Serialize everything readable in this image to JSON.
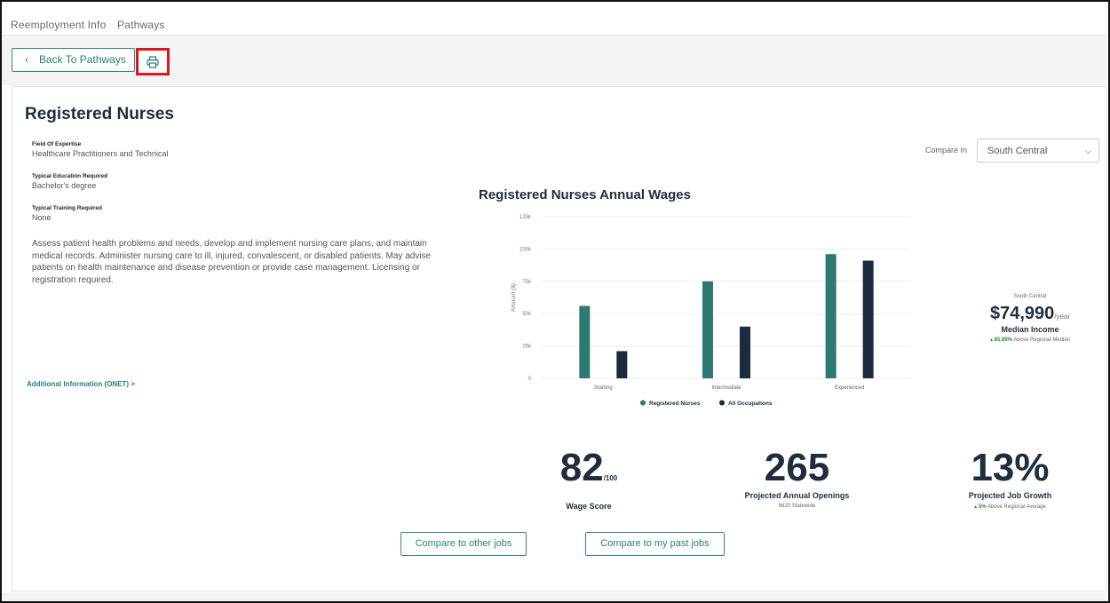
{
  "nav": {
    "reemployment_info": "Reemployment Info",
    "pathways": "Pathways",
    "back_button": "Back To Pathways",
    "print_icon": "printer-icon"
  },
  "occupation": {
    "title": "Registered Nurses",
    "field_of_expertise_label": "Field Of Expertise",
    "field_of_expertise": "Healthcare Practitioners and Technical",
    "education_label": "Typical Education Required",
    "education": "Bachelor's degree",
    "training_label": "Typical Training Required",
    "training": "None",
    "description": "Assess patient health problems and needs, develop and implement nursing care plans, and maintain medical records. Administer nursing care to ill, injured, convalescent, or disabled patients. May advise patients on health maintenance and disease prevention or provide case management. Licensing or registration required.",
    "additional_info": "Additional Information (ONET) >"
  },
  "compare": {
    "label": "Compare In",
    "selected_region": "South Central"
  },
  "median_income": {
    "region": "South Central",
    "value": "$74,990",
    "per": "/year",
    "label": "Median Income",
    "delta": "85.89%",
    "delta_text": "Above Regional Median"
  },
  "stats": {
    "wage_score": "82",
    "wage_score_suffix": "/100",
    "wage_score_label": "Wage Score",
    "openings": "265",
    "openings_label": "Projected Annual Openings",
    "openings_note": "6620 Statewide",
    "growth": "13%",
    "growth_label": "Projected Job Growth",
    "growth_delta": "5%",
    "growth_delta_text": "Above Regional Average"
  },
  "buttons": {
    "compare_other": "Compare to other jobs",
    "compare_past": "Compare to my past jobs"
  },
  "colors": {
    "accent": "#2a7d78",
    "registered_nurses": "#2a7a72",
    "all_occupations": "#1b2a3f",
    "print_highlight": "#e2141c"
  },
  "chart_data": {
    "type": "bar",
    "title": "Registered Nurses Annual Wages",
    "ylabel": "Amount ($)",
    "xlabel": "",
    "ylim": [
      0,
      125000
    ],
    "ytick_values": [
      0,
      25000,
      50000,
      75000,
      100000,
      125000
    ],
    "ytick_labels": [
      "0",
      "25k",
      "50k",
      "75k",
      "100k",
      "125k"
    ],
    "categories": [
      "Starting",
      "Intermediate",
      "Experienced"
    ],
    "series": [
      {
        "name": "Registered Nurses",
        "values": [
          56000,
          75000,
          96000
        ]
      },
      {
        "name": "All Occupations",
        "values": [
          21000,
          40000,
          91000
        ]
      }
    ],
    "legend": "bottom",
    "grid": true
  }
}
